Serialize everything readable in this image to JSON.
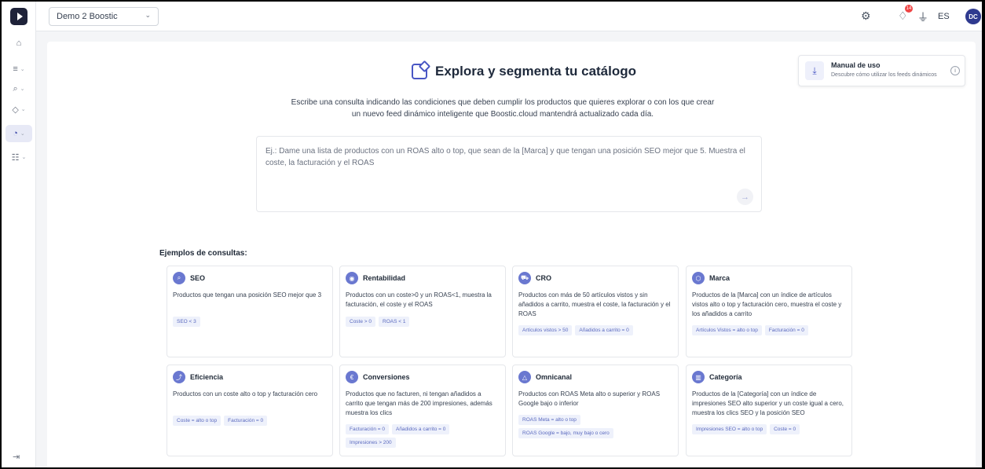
{
  "colors": {
    "accent": "#4956c4",
    "sidebar_active": "#e7e9f6",
    "chip_bg": "#eef1fb",
    "chip_text": "#5b6abf",
    "badge": "#ef4444"
  },
  "topbar": {
    "account": "Demo 2 Boostic",
    "notifications_count": "14",
    "language": "ES",
    "avatar_initials": "DC"
  },
  "sidebar": {
    "items": [
      {
        "icon": "home-icon"
      },
      {
        "icon": "analytics-icon"
      },
      {
        "icon": "search-icon"
      },
      {
        "icon": "tag-icon"
      },
      {
        "icon": "gauge-icon",
        "active": true
      },
      {
        "icon": "sliders-icon"
      }
    ],
    "collapse_icon": "collapse-sidebar-icon"
  },
  "main": {
    "title": "Explora y segmenta tu catálogo",
    "subtitle_line1": "Escribe una consulta indicando las condiciones que deben cumplir los productos que quieres explorar o con los que crear",
    "subtitle_line2": "un nuevo feed dinámico inteligente que Boostic.cloud mantendrá actualizado cada día.",
    "query_placeholder": "Ej.: Dame una lista de productos con un ROAS alto o top, que sean de la [Marca] y que tengan una posición SEO mejor que 5. Muestra el coste, la facturación y el ROAS"
  },
  "manual": {
    "title": "Manual de uso",
    "description": "Descubre cómo utilizar los feeds dinámicos"
  },
  "examples": {
    "label": "Ejemplos de consultas:",
    "cards": [
      {
        "title": "SEO",
        "icon": "search-icon",
        "description": "Productos que tengan una posición SEO mejor que 3",
        "chips": [
          "SEO < 3"
        ]
      },
      {
        "title": "Rentabilidad",
        "icon": "eye-icon",
        "description": "Productos con un coste>0 y un ROAS<1, muestra la facturación, el coste y el ROAS",
        "chips": [
          "Coste > 0",
          "ROAS < 1"
        ]
      },
      {
        "title": "CRO",
        "icon": "cart-icon",
        "description": "Productos con más de 50 artículos vistos y sin añadidos a carrito, muestra el coste, la facturación y el ROAS",
        "chips": [
          "Artículos vistos > 50",
          "Añadidos a carrito = 0"
        ]
      },
      {
        "title": "Marca",
        "icon": "hexagon-icon",
        "description": "Productos de la [Marca] con un índice de artículos vistos alto o top y facturación cero, muestra el coste y los añadidos a carrito",
        "chips": [
          "Artículos Vistos = alto o top",
          "Facturación = 0"
        ]
      },
      {
        "title": "Eficiencia",
        "icon": "chart-icon",
        "description": "Productos con un coste alto o top y facturación cero",
        "chips": [
          "Coste = alto o top",
          "Facturación = 0"
        ]
      },
      {
        "title": "Conversiones",
        "icon": "euro-icon",
        "description": "Productos que no facturen, ni tengan añadidos a carrito que tengan más de 200 impresiones, además muestra los clics",
        "chips": [
          "Facturación = 0",
          "Añadidos a carrito = 0",
          "Impresiones > 200"
        ]
      },
      {
        "title": "Omnicanal",
        "icon": "triangle-icon",
        "description": "Productos con ROAS Meta alto o superior y ROAS Google bajo o inferior",
        "chips": [
          "ROAS Meta = alto o top",
          "ROAS Google = bajo, muy bajo o cero"
        ]
      },
      {
        "title": "Categoría",
        "icon": "library-icon",
        "description": "Productos de la [Categoría] con un índice de impresiones SEO alto superior y un coste igual a cero, muestra los clics SEO y la posición SEO",
        "chips": [
          "Impresiones SEO = alto o top",
          "Coste = 0"
        ]
      }
    ]
  }
}
